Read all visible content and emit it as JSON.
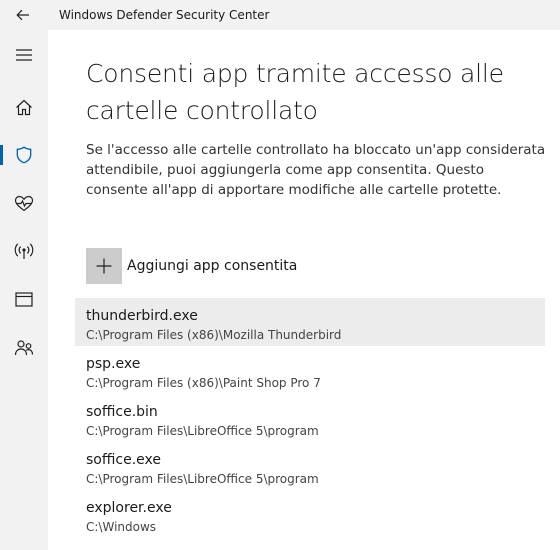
{
  "window": {
    "title": "Windows Defender Security Center"
  },
  "sidebar": {
    "items": [
      {
        "icon": "hamburger-menu-icon"
      },
      {
        "icon": "home-icon"
      },
      {
        "icon": "shield-icon",
        "active": true
      },
      {
        "icon": "heart-pulse-icon"
      },
      {
        "icon": "wireless-icon"
      },
      {
        "icon": "browser-window-icon"
      },
      {
        "icon": "family-icon"
      }
    ]
  },
  "main": {
    "heading": "Consenti app tramite accesso alle cartelle controllato",
    "description": "Se l'accesso alle cartelle controllato ha bloccato un'app considerata attendibile, puoi aggiungerla come app consentita. Questo consente all'app di apportare modifiche alle cartelle protette.",
    "add_button_label": "Aggiungi app consentita",
    "apps": [
      {
        "name": "thunderbird.exe",
        "path": "C:\\Program Files (x86)\\Mozilla Thunderbird"
      },
      {
        "name": "psp.exe",
        "path": "C:\\Program Files (x86)\\Paint Shop Pro 7"
      },
      {
        "name": "soffice.bin",
        "path": "C:\\Program Files\\LibreOffice 5\\program"
      },
      {
        "name": "soffice.exe",
        "path": "C:\\Program Files\\LibreOffice 5\\program"
      },
      {
        "name": "explorer.exe",
        "path": "C:\\Windows"
      }
    ]
  },
  "colors": {
    "accent": "#0063b1",
    "chrome": "#f2f2f2",
    "selected_row": "#ececec",
    "add_button": "#cccccc"
  }
}
